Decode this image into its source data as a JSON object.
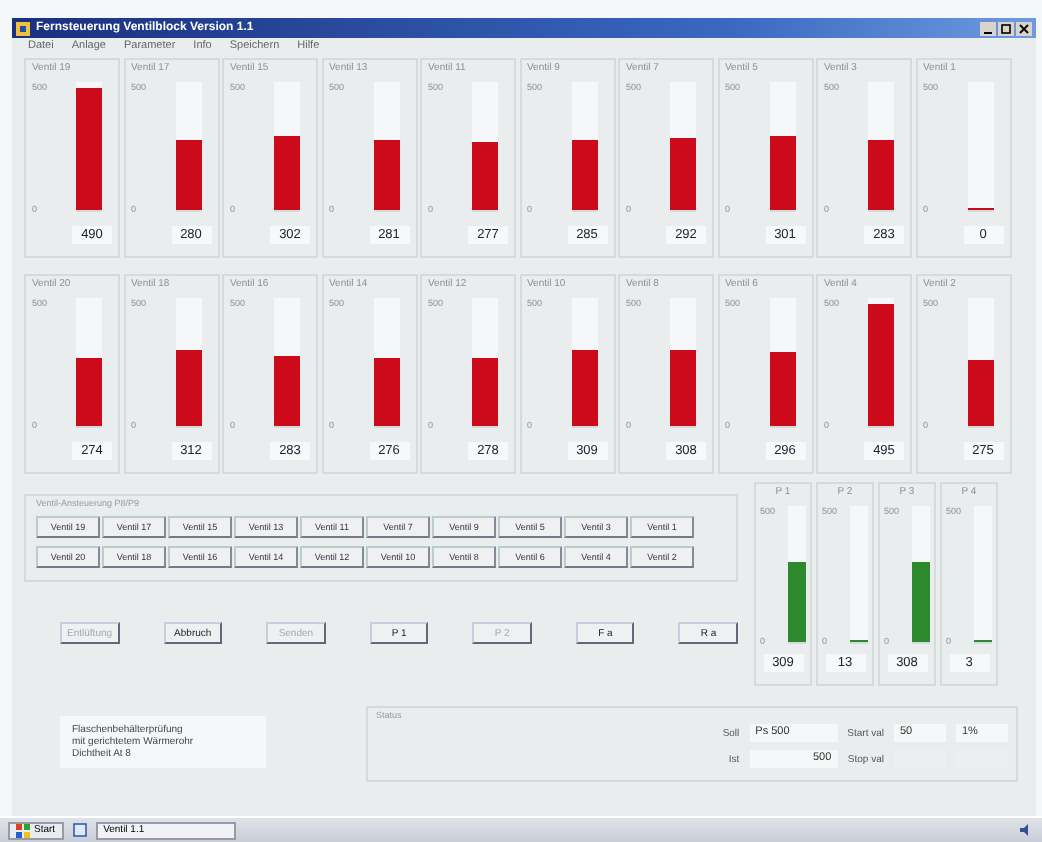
{
  "window": {
    "title": "Fernsteuerung Ventilblock Version 1.1"
  },
  "menu": [
    "Datei",
    "Anlage",
    "Parameter",
    "Info",
    "Speichern",
    "Hilfe"
  ],
  "gauge_rows": [
    [
      {
        "label": "Ventil 19",
        "max": "500",
        "min": "0",
        "value": "490",
        "level": 0.98
      },
      {
        "label": "Ventil 17",
        "max": "500",
        "min": "0",
        "value": "280",
        "level": 0.56
      },
      {
        "label": "Ventil 15",
        "max": "500",
        "min": "0",
        "value": "302",
        "level": 0.6
      },
      {
        "label": "Ventil 13",
        "max": "500",
        "min": "0",
        "value": "281",
        "level": 0.56
      },
      {
        "label": "Ventil 11",
        "max": "500",
        "min": "0",
        "value": "277",
        "level": 0.55
      },
      {
        "label": "Ventil 9",
        "max": "500",
        "min": "0",
        "value": "285",
        "level": 0.57
      },
      {
        "label": "Ventil 7",
        "max": "500",
        "min": "0",
        "value": "292",
        "level": 0.58
      },
      {
        "label": "Ventil 5",
        "max": "500",
        "min": "0",
        "value": "301",
        "level": 0.6
      },
      {
        "label": "Ventil 3",
        "max": "500",
        "min": "0",
        "value": "283",
        "level": 0.57
      },
      {
        "label": "Ventil 1",
        "max": "500",
        "min": "0",
        "value": "0",
        "level": 0
      }
    ],
    [
      {
        "label": "Ventil 20",
        "max": "500",
        "min": "0",
        "value": "274",
        "level": 0.55
      },
      {
        "label": "Ventil 18",
        "max": "500",
        "min": "0",
        "value": "312",
        "level": 0.62
      },
      {
        "label": "Ventil 16",
        "max": "500",
        "min": "0",
        "value": "283",
        "level": 0.56
      },
      {
        "label": "Ventil 14",
        "max": "500",
        "min": "0",
        "value": "276",
        "level": 0.55
      },
      {
        "label": "Ventil 12",
        "max": "500",
        "min": "0",
        "value": "278",
        "level": 0.55
      },
      {
        "label": "Ventil 10",
        "max": "500",
        "min": "0",
        "value": "309",
        "level": 0.61
      },
      {
        "label": "Ventil 8",
        "max": "500",
        "min": "0",
        "value": "308",
        "level": 0.61
      },
      {
        "label": "Ventil 6",
        "max": "500",
        "min": "0",
        "value": "296",
        "level": 0.59
      },
      {
        "label": "Ventil 4",
        "max": "500",
        "min": "0",
        "value": "495",
        "level": 0.99
      },
      {
        "label": "Ventil 2",
        "max": "500",
        "min": "0",
        "value": "275",
        "level": 0.54
      }
    ]
  ],
  "valve_group": {
    "title": "Ventil-Ansteuerung P8/P9",
    "rows": [
      [
        "Ventil 19",
        "Ventil 17",
        "Ventil 15",
        "Ventil 13",
        "Ventil 11",
        "Ventil 7",
        "Ventil 9",
        "Ventil 5",
        "Ventil 3",
        "Ventil 1"
      ],
      [
        "Ventil 20",
        "Ventil 18",
        "Ventil 16",
        "Ventil 14",
        "Ventil 12",
        "Ventil 10",
        "Ventil 8",
        "Ventil 6",
        "Ventil 4",
        "Ventil 2"
      ]
    ]
  },
  "actions": [
    {
      "label": "Entlüftung",
      "disabled": true
    },
    {
      "label": "Abbruch",
      "disabled": false
    },
    {
      "label": "Senden",
      "disabled": true
    },
    {
      "label": "P 1",
      "disabled": false
    },
    {
      "label": "P 2",
      "disabled": true
    },
    {
      "label": "F a",
      "disabled": false
    },
    {
      "label": "R a",
      "disabled": false
    }
  ],
  "pressure_gauges": [
    {
      "label": "P 1",
      "max": "500",
      "min": "0",
      "value": "309",
      "level": 0.6
    },
    {
      "label": "P 2",
      "max": "500",
      "min": "0",
      "value": "13",
      "level": 0.02
    },
    {
      "label": "P 3",
      "max": "500",
      "min": "0",
      "value": "308",
      "level": 0.6
    },
    {
      "label": "P 4",
      "max": "500",
      "min": "0",
      "value": "3",
      "level": 0
    }
  ],
  "info_lines": [
    "Flaschenbehälterprüfung",
    "mit gerichtetem Wärmerohr",
    "Dichtheit At 8"
  ],
  "readout": {
    "title": "Status",
    "soll_label": "Soll",
    "soll": "Ps 500",
    "ist_label": "Ist",
    "ist": "500",
    "start_label": "Start val",
    "start_1": "50",
    "start_2": "1%",
    "stop_label": "Stop val"
  },
  "taskbar": {
    "start": "Start",
    "task": "Ventil 1.1"
  }
}
